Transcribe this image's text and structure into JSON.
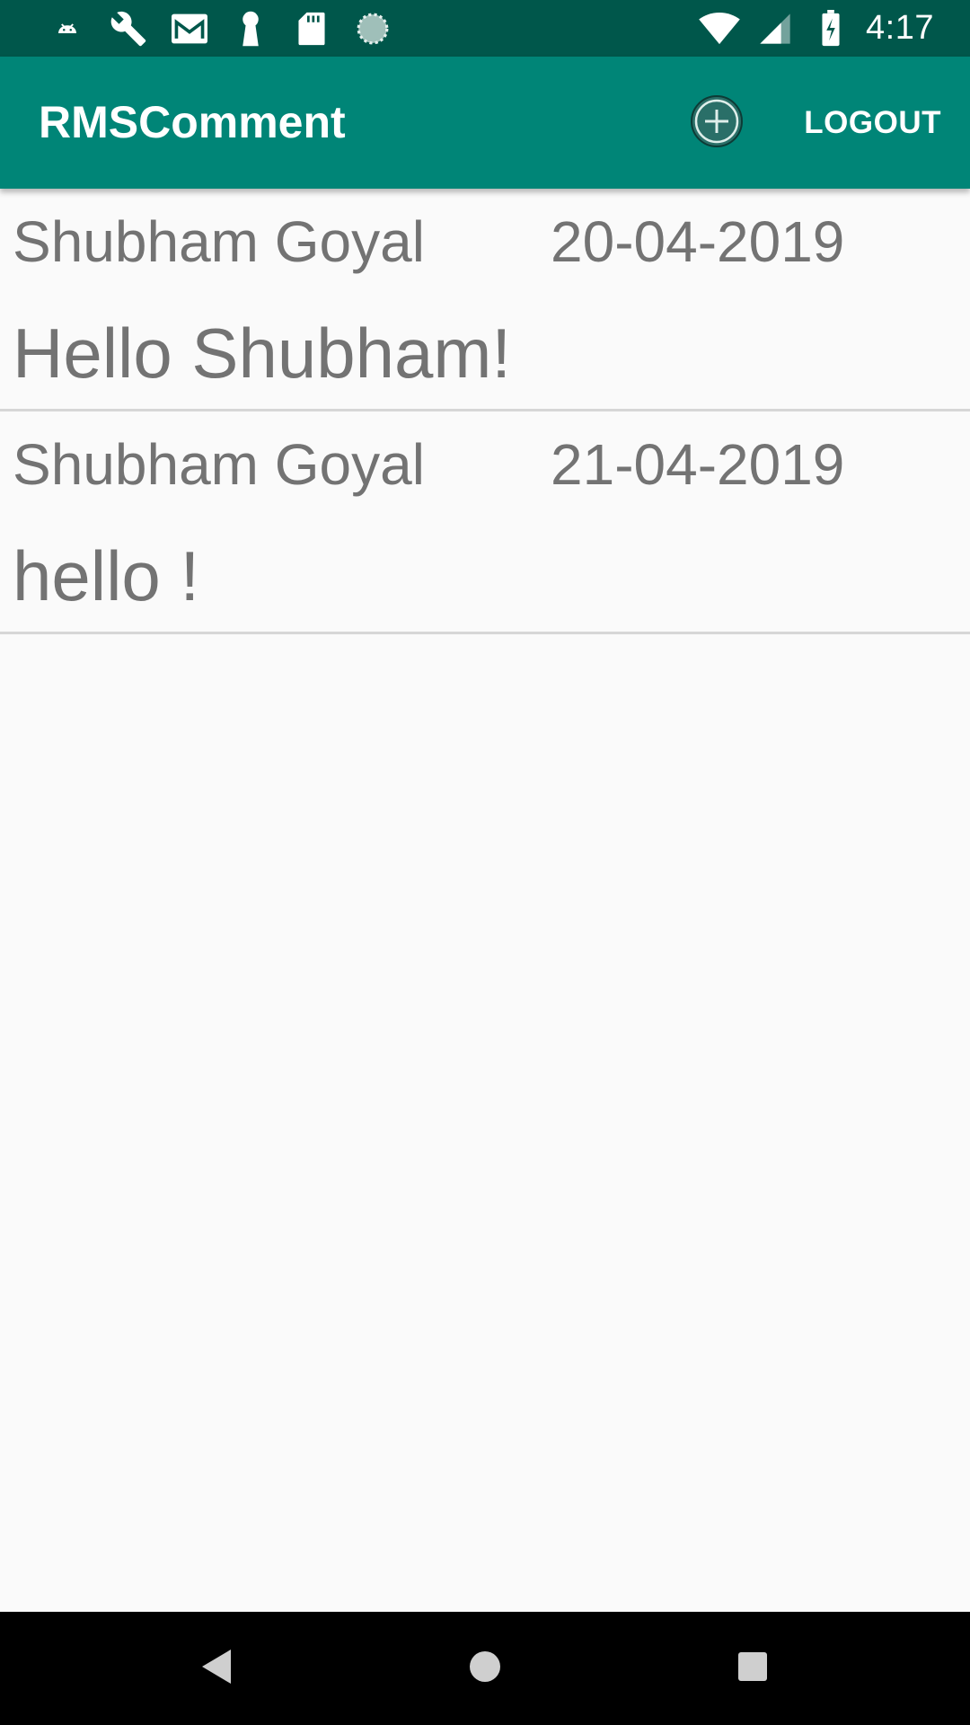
{
  "status_bar": {
    "time": "4:17",
    "icons_left": [
      "android-notification-icon",
      "wrench-icon",
      "gmail-icon",
      "keyhole-icon",
      "sd-card-icon",
      "sync-progress-icon"
    ],
    "icons_right": [
      "wifi-icon",
      "cell-signal-icon",
      "battery-charging-icon"
    ]
  },
  "app_bar": {
    "title": "RMSComment",
    "add_icon": "add-circle-icon",
    "logout_label": "LOGOUT",
    "background_color": "#008577",
    "status_bar_color": "#00574B"
  },
  "comments": [
    {
      "author": "Shubham Goyal",
      "date": "20-04-2019",
      "text": "Hello Shubham!"
    },
    {
      "author": "Shubham Goyal",
      "date": "21-04-2019",
      "text": "hello !"
    }
  ],
  "nav_bar": {
    "buttons": [
      "back-icon",
      "home-icon",
      "recents-icon"
    ]
  }
}
